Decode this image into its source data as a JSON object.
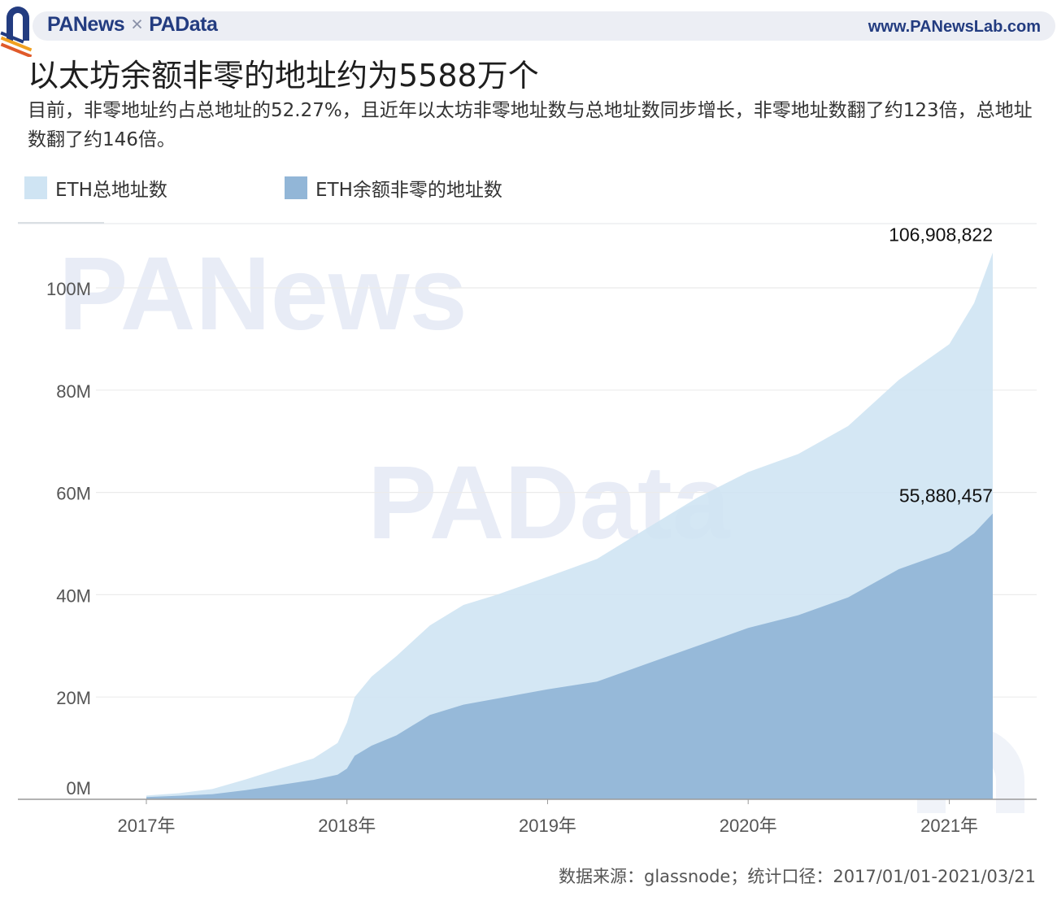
{
  "header": {
    "brand_left": "PANews",
    "brand_sep": "×",
    "brand_right": "PAData",
    "site": "www.PANewsLab.com"
  },
  "title": "以太坊余额非零的地址约为5588万个",
  "subtitle": "目前，非零地址约占总地址的52.27%，且近年以太坊非零地址数与总地址数同步增长，非零地址数翻了约123倍，总地址数翻了约146倍。",
  "legend": [
    {
      "label": "ETH总地址数",
      "color": "#cfe4f3"
    },
    {
      "label": "ETH余额非零的地址数",
      "color": "#92b6d7"
    }
  ],
  "footer": "数据来源：glassnode；统计口径：2017/01/01-2021/03/21",
  "watermarks": [
    "PANews",
    "PAData"
  ],
  "chart_data": {
    "type": "area",
    "title": "以太坊余额非零的地址约为5588万个",
    "xlabel": "",
    "ylabel": "",
    "ylim": [
      0,
      107000000
    ],
    "y_ticks": [
      0,
      20000000,
      40000000,
      60000000,
      80000000,
      100000000
    ],
    "y_tick_labels": [
      "0M",
      "20M",
      "40M",
      "60M",
      "80M",
      "100M"
    ],
    "x_ticks": [
      "2017-01-01",
      "2018-01-01",
      "2019-01-01",
      "2020-01-01",
      "2021-01-01"
    ],
    "x_tick_labels": [
      "2017年",
      "2018年",
      "2019年",
      "2020年",
      "2021年"
    ],
    "grid": true,
    "legend_position": "top-left",
    "x": [
      "2017-01-01",
      "2017-03-01",
      "2017-05-01",
      "2017-07-01",
      "2017-09-01",
      "2017-11-01",
      "2017-12-15",
      "2018-01-01",
      "2018-01-15",
      "2018-02-15",
      "2018-04-01",
      "2018-06-01",
      "2018-08-01",
      "2018-10-01",
      "2019-01-01",
      "2019-04-01",
      "2019-07-01",
      "2019-10-01",
      "2020-01-01",
      "2020-04-01",
      "2020-07-01",
      "2020-10-01",
      "2021-01-01",
      "2021-02-15",
      "2021-03-21"
    ],
    "series": [
      {
        "name": "ETH总地址数",
        "color": "#cfe4f3",
        "values": [
          730000,
          1200000,
          2000000,
          3900000,
          6000000,
          8000000,
          11000000,
          15000000,
          20000000,
          24000000,
          28000000,
          34000000,
          38000000,
          40000000,
          43500000,
          47000000,
          53000000,
          59000000,
          64000000,
          67500000,
          73000000,
          82000000,
          89000000,
          97000000,
          106908822
        ]
      },
      {
        "name": "ETH余额非零的地址数",
        "color": "#92b6d7",
        "values": [
          450000,
          700000,
          1000000,
          1800000,
          2800000,
          3800000,
          4800000,
          6000000,
          8500000,
          10500000,
          12500000,
          16500000,
          18500000,
          19700000,
          21500000,
          23000000,
          26500000,
          30000000,
          33500000,
          36000000,
          39500000,
          45000000,
          48500000,
          52000000,
          55880457
        ]
      }
    ],
    "end_labels": [
      "106,908,822",
      "55,880,457"
    ]
  }
}
